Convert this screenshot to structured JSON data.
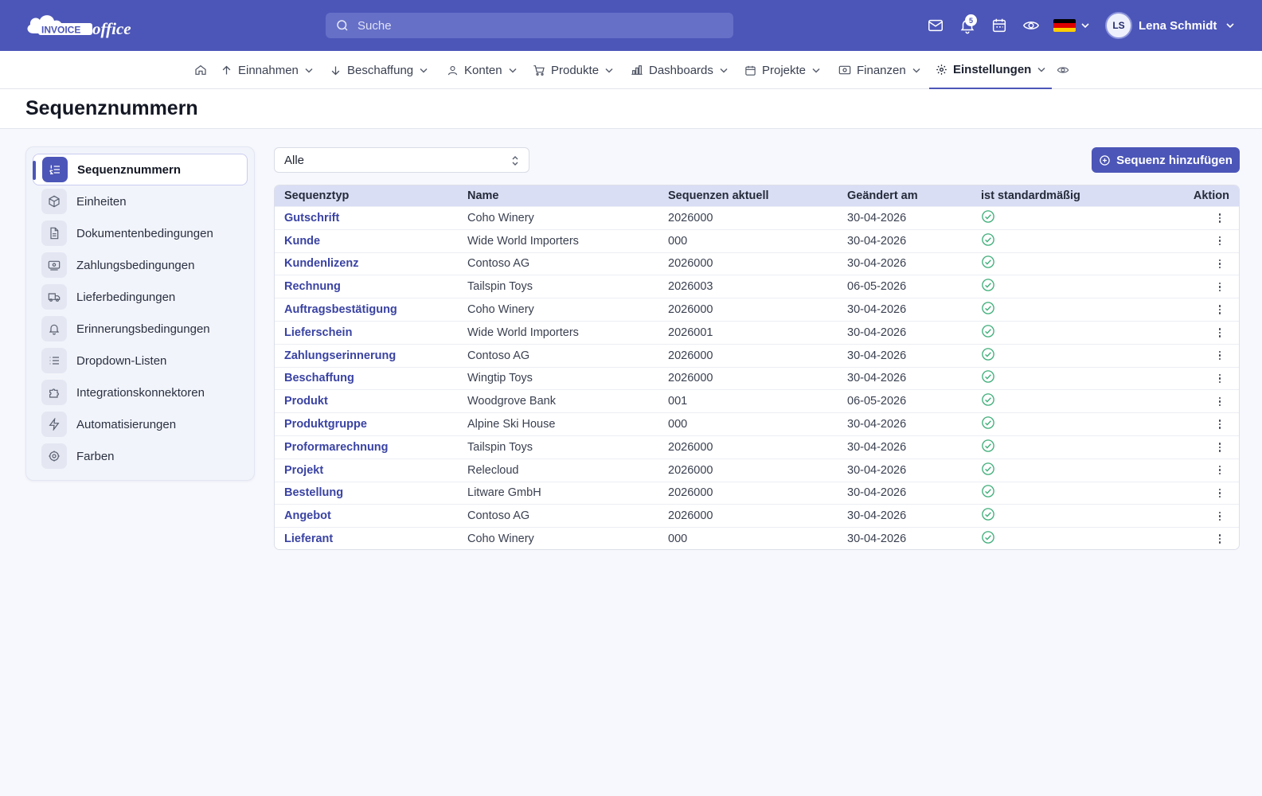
{
  "app": {
    "logo": {
      "word1": "INVOICE",
      "word2": "office"
    },
    "search_placeholder": "Suche",
    "notification_count": "5",
    "language_flag_colors": [
      "#000000",
      "#dd0000",
      "#ffce00"
    ],
    "user": {
      "initials": "LS",
      "name": "Lena Schmidt"
    }
  },
  "nav": {
    "items": [
      {
        "label": "",
        "icon": "home-icon"
      },
      {
        "label": "Einnahmen",
        "icon": "arrow-up-icon"
      },
      {
        "label": "Beschaffung",
        "icon": "arrow-down-icon"
      },
      {
        "label": "Konten",
        "icon": "user-icon"
      },
      {
        "label": "Produkte",
        "icon": "cart-icon"
      },
      {
        "label": "Dashboards",
        "icon": "bar-chart-icon"
      },
      {
        "label": "Projekte",
        "icon": "calendar-icon"
      },
      {
        "label": "Finanzen",
        "icon": "money-icon"
      },
      {
        "label": "Einstellungen",
        "icon": "gear-icon",
        "active": true
      },
      {
        "label": "",
        "icon": "eye-icon"
      }
    ]
  },
  "page": {
    "title": "Sequenznummern"
  },
  "sidebar": {
    "items": [
      {
        "label": "Sequenznummern",
        "icon": "list-numbered-icon",
        "active": true
      },
      {
        "label": "Einheiten",
        "icon": "cube-icon"
      },
      {
        "label": "Dokumentenbedingungen",
        "icon": "document-icon"
      },
      {
        "label": "Zahlungsbedingungen",
        "icon": "payment-icon"
      },
      {
        "label": "Lieferbedingungen",
        "icon": "truck-icon"
      },
      {
        "label": "Erinnerungsbedingungen",
        "icon": "bell-icon"
      },
      {
        "label": "Dropdown-Listen",
        "icon": "list-icon"
      },
      {
        "label": "Integrationskonnektoren",
        "icon": "puzzle-icon"
      },
      {
        "label": "Automatisierungen",
        "icon": "lightning-icon"
      },
      {
        "label": "Farben",
        "icon": "cog-icon"
      }
    ]
  },
  "filter": {
    "value": "Alle"
  },
  "add_button": {
    "label": "Sequenz hinzufügen"
  },
  "table": {
    "headers": {
      "type": "Sequenztyp",
      "name": "Name",
      "current": "Sequenzen aktuell",
      "changed": "Geändert am",
      "default": "ist standardmäßig",
      "action": "Aktion"
    },
    "rows": [
      {
        "type": "Gutschrift",
        "name": "Coho Winery",
        "current": "2026000",
        "changed": "30-04-2026"
      },
      {
        "type": "Kunde",
        "name": "Wide World Importers",
        "current": "000",
        "changed": "30-04-2026"
      },
      {
        "type": "Kundenlizenz",
        "name": "Contoso AG",
        "current": "2026000",
        "changed": "30-04-2026"
      },
      {
        "type": "Rechnung",
        "name": "Tailspin Toys",
        "current": "2026003",
        "changed": "06-05-2026"
      },
      {
        "type": "Auftragsbestätigung",
        "name": "Coho Winery",
        "current": "2026000",
        "changed": "30-04-2026"
      },
      {
        "type": "Lieferschein",
        "name": "Wide World Importers",
        "current": "2026001",
        "changed": "30-04-2026"
      },
      {
        "type": "Zahlungserinnerung",
        "name": "Contoso AG",
        "current": "2026000",
        "changed": "30-04-2026"
      },
      {
        "type": "Beschaffung",
        "name": "Wingtip Toys",
        "current": "2026000",
        "changed": "30-04-2026"
      },
      {
        "type": "Produkt",
        "name": "Woodgrove Bank",
        "current": "001",
        "changed": "06-05-2026"
      },
      {
        "type": "Produktgruppe",
        "name": "Alpine Ski House",
        "current": "000",
        "changed": "30-04-2026"
      },
      {
        "type": "Proformarechnung",
        "name": "Tailspin Toys",
        "current": "2026000",
        "changed": "30-04-2026"
      },
      {
        "type": "Projekt",
        "name": "Relecloud",
        "current": "2026000",
        "changed": "30-04-2026"
      },
      {
        "type": "Bestellung",
        "name": "Litware GmbH",
        "current": "2026000",
        "changed": "30-04-2026"
      },
      {
        "type": "Angebot",
        "name": "Contoso AG",
        "current": "2026000",
        "changed": "30-04-2026"
      },
      {
        "type": "Lieferant",
        "name": "Coho Winery",
        "current": "000",
        "changed": "30-04-2026"
      }
    ]
  },
  "colors": {
    "brand": "#4c56b8",
    "check": "#3fae7a"
  }
}
